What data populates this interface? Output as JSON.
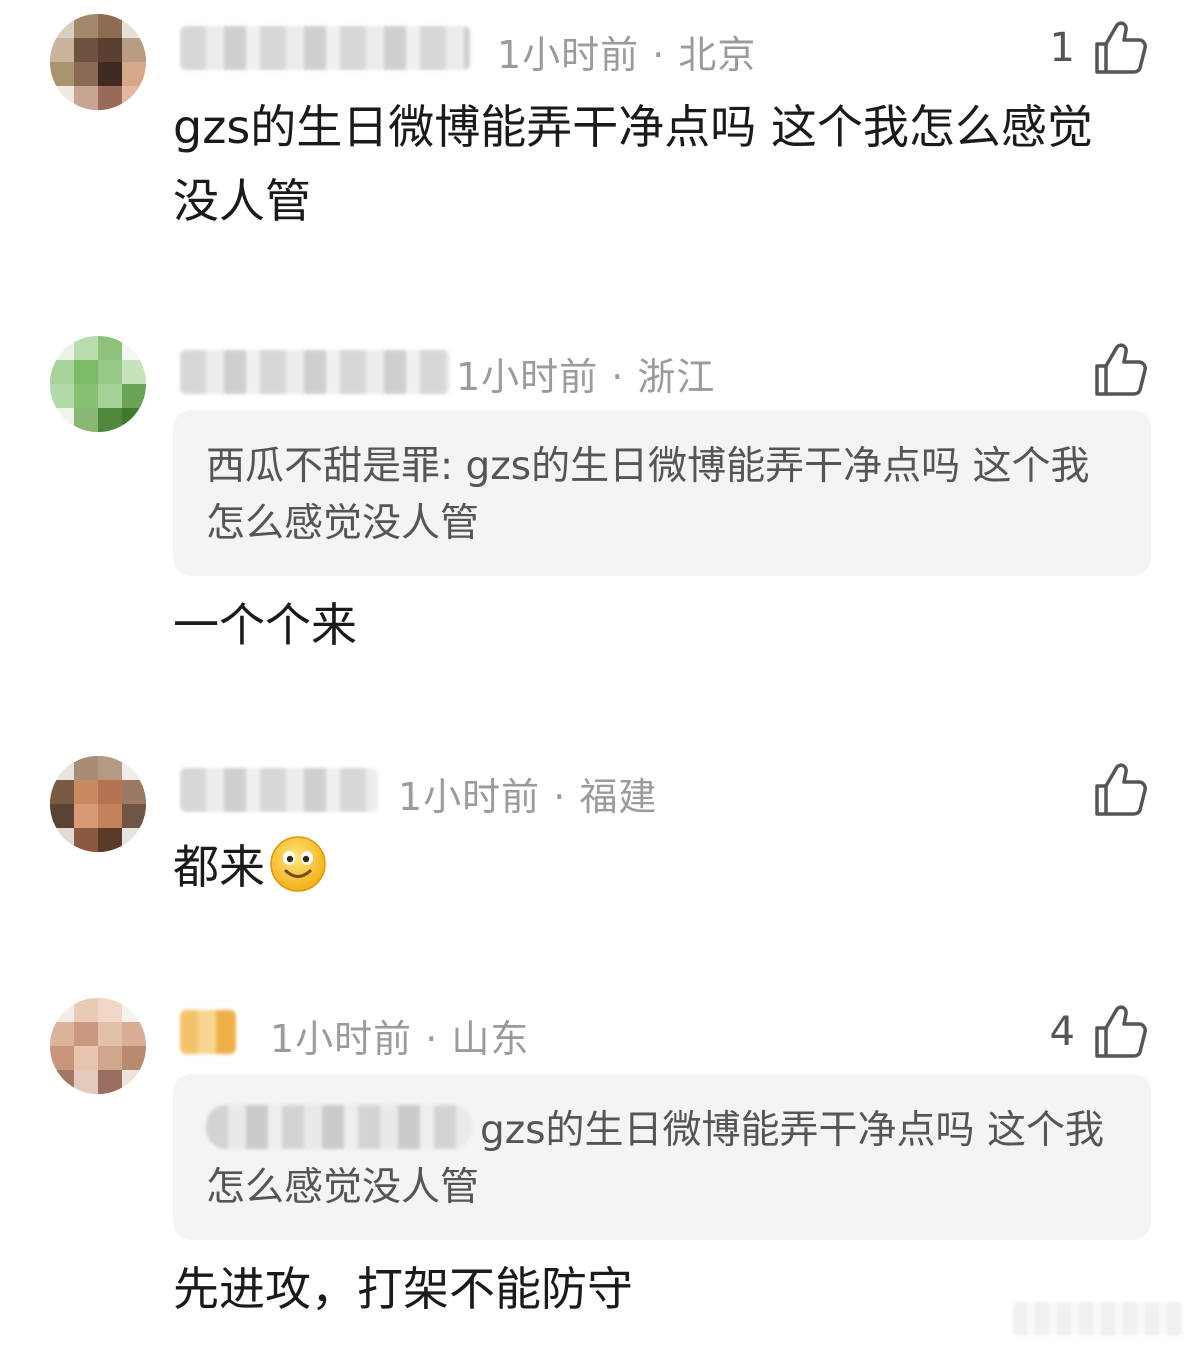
{
  "comments": [
    {
      "meta": "1小时前 · 北京",
      "likes": "1",
      "text": "gzs的生日微博能弄干净点吗 这个我怎么感觉没人管"
    },
    {
      "meta": "1小时前 · 浙江",
      "likes": "",
      "quote": {
        "author": "西瓜不甜是罪:",
        "text": "gzs的生日微博能弄干净点吗 这个我怎么感觉没人管"
      },
      "text": "一个个来"
    },
    {
      "meta": "1小时前 · 福建",
      "likes": "",
      "text": "都来"
    },
    {
      "meta": "1小时前 · 山东",
      "likes": "4",
      "quote": {
        "text": "gzs的生日微博能弄干净点吗 这个我怎么感觉没人管"
      },
      "text": "先进攻，打架不能防守"
    }
  ],
  "icons": {
    "like": "thumbs-up-icon",
    "emoji": "smiley-face-icon"
  },
  "colors": {
    "meta_text": "#9b9b9b",
    "quote_bg": "#f4f4f4",
    "body_text": "#1a1a1a"
  }
}
